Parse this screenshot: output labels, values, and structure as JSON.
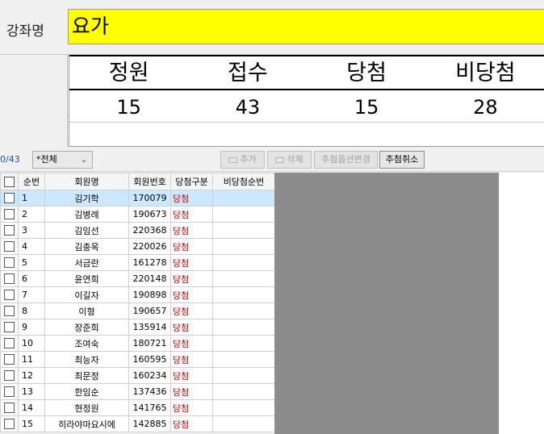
{
  "course": {
    "label": "강좌명",
    "value": "요가"
  },
  "summary": {
    "headers": [
      "정원",
      "접수",
      "당첨",
      "비당첨"
    ],
    "values": [
      "15",
      "43",
      "15",
      "28"
    ]
  },
  "toolbar": {
    "counter": "0/43",
    "filter_value": "*전체",
    "add_label": "추가",
    "delete_label": "삭제",
    "option_change_label": "추첨옵션변경",
    "cancel_draw_label": "추첨취소"
  },
  "grid": {
    "columns": [
      "순번",
      "회원명",
      "회원번호",
      "당첨구분",
      "비당첨순번"
    ],
    "rows": [
      {
        "no": "1",
        "name": "김기학",
        "id": "170079",
        "type": "당첨",
        "rank": ""
      },
      {
        "no": "2",
        "name": "김병례",
        "id": "190673",
        "type": "당첨",
        "rank": ""
      },
      {
        "no": "3",
        "name": "김임선",
        "id": "220368",
        "type": "당첨",
        "rank": ""
      },
      {
        "no": "4",
        "name": "김충옥",
        "id": "220026",
        "type": "당첨",
        "rank": ""
      },
      {
        "no": "5",
        "name": "서금란",
        "id": "161278",
        "type": "당첨",
        "rank": ""
      },
      {
        "no": "6",
        "name": "윤연희",
        "id": "220148",
        "type": "당첨",
        "rank": ""
      },
      {
        "no": "7",
        "name": "이길자",
        "id": "190898",
        "type": "당첨",
        "rank": ""
      },
      {
        "no": "8",
        "name": "이형",
        "id": "190657",
        "type": "당첨",
        "rank": ""
      },
      {
        "no": "9",
        "name": "장준희",
        "id": "135914",
        "type": "당첨",
        "rank": ""
      },
      {
        "no": "10",
        "name": "조여숙",
        "id": "180721",
        "type": "당첨",
        "rank": ""
      },
      {
        "no": "11",
        "name": "최능자",
        "id": "160595",
        "type": "당첨",
        "rank": ""
      },
      {
        "no": "12",
        "name": "최문정",
        "id": "160234",
        "type": "당첨",
        "rank": ""
      },
      {
        "no": "13",
        "name": "한임순",
        "id": "137436",
        "type": "당첨",
        "rank": ""
      },
      {
        "no": "14",
        "name": "현정원",
        "id": "141765",
        "type": "당첨",
        "rank": ""
      },
      {
        "no": "15",
        "name": "히라야마요시에",
        "id": "142885",
        "type": "당첨",
        "rank": ""
      }
    ]
  },
  "colors": {
    "course_bg": "#ffff00",
    "win_text": "#d00000",
    "selected_row": "#cce8ff",
    "counter": "#1e4fb4"
  }
}
